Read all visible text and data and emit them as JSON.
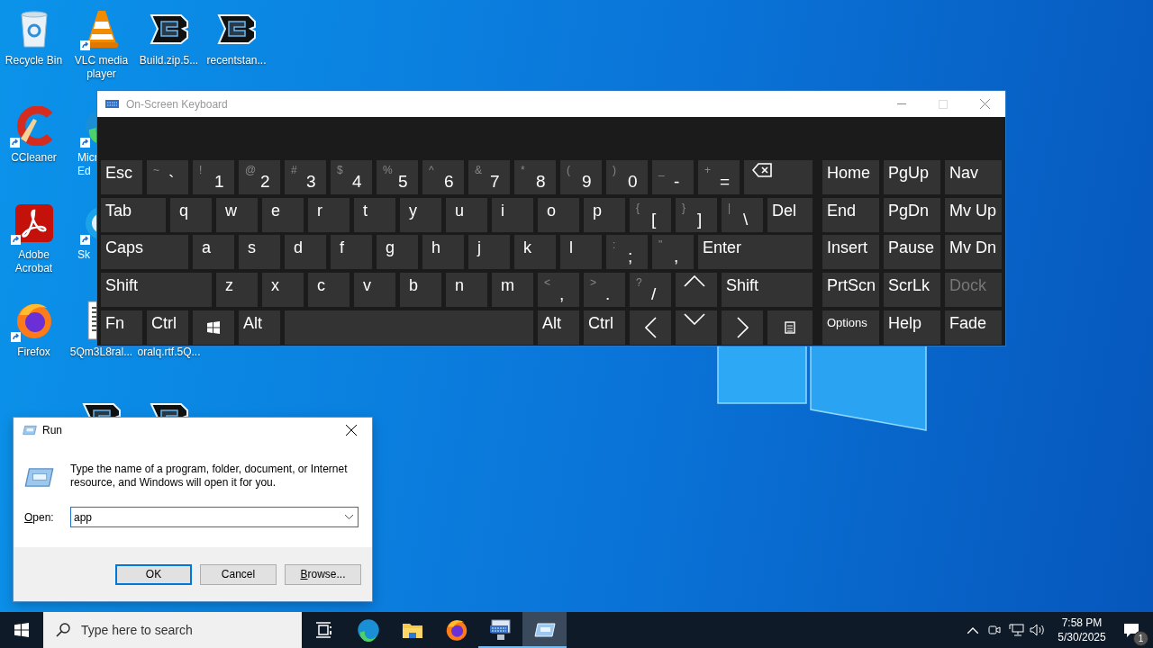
{
  "desktop": {
    "icons": [
      {
        "label": "Recycle Bin",
        "kind": "recycle",
        "shortcut": false
      },
      {
        "label": "VLC media player",
        "kind": "cone",
        "shortcut": true
      },
      {
        "label": "Build.zip.5...",
        "kind": "logo",
        "shortcut": false
      },
      {
        "label": "recentstan...",
        "kind": "logo",
        "shortcut": false
      },
      {
        "label": "CCleaner",
        "kind": "cleaner",
        "shortcut": true
      },
      {
        "lines": [
          "Micr",
          "Ed"
        ],
        "kind": "edge",
        "shortcut": true
      },
      {
        "label": "Adobe Acrobat",
        "kind": "acrobat",
        "shortcut": true
      },
      {
        "lines": [
          "Sk"
        ],
        "kind": "skype",
        "shortcut": true
      },
      {
        "label": "Firefox",
        "kind": "firefox",
        "shortcut": true
      },
      {
        "label": "5Qm3L8ral...",
        "kind": "document",
        "shortcut": false
      },
      {
        "label": "oralq.rtf.5Q..."
      },
      {
        "kind": "logo"
      },
      {
        "kind": "logo"
      }
    ]
  },
  "keyboard": {
    "title": "On-Screen Keyboard",
    "active": false,
    "rows": [
      {
        "keys": [
          {
            "label": "Esc"
          },
          {
            "label": "`",
            "shift": "~"
          },
          {
            "label": "1",
            "shift": "!"
          },
          {
            "label": "2",
            "shift": "@"
          },
          {
            "label": "3",
            "shift": "#"
          },
          {
            "label": "4",
            "shift": "$"
          },
          {
            "label": "5",
            "shift": "%"
          },
          {
            "label": "6",
            "shift": "^"
          },
          {
            "label": "7",
            "shift": "&"
          },
          {
            "label": "8",
            "shift": "*"
          },
          {
            "label": "9",
            "shift": "("
          },
          {
            "label": "0",
            "shift": ")"
          },
          {
            "label": "-",
            "shift": "_"
          },
          {
            "label": "=",
            "shift": "+"
          },
          {
            "kind": "backspace"
          }
        ]
      },
      {
        "keys": [
          {
            "label": "Tab"
          },
          {
            "label": "q"
          },
          {
            "label": "w"
          },
          {
            "label": "e"
          },
          {
            "label": "r"
          },
          {
            "label": "t"
          },
          {
            "label": "y"
          },
          {
            "label": "u"
          },
          {
            "label": "i"
          },
          {
            "label": "o"
          },
          {
            "label": "p"
          },
          {
            "label": "[",
            "shift": "{"
          },
          {
            "label": "]",
            "shift": "}"
          },
          {
            "label": "\\",
            "shift": "|"
          },
          {
            "label": "Del"
          }
        ]
      },
      {
        "keys": [
          {
            "label": "Caps"
          },
          {
            "label": "a"
          },
          {
            "label": "s"
          },
          {
            "label": "d"
          },
          {
            "label": "f"
          },
          {
            "label": "g"
          },
          {
            "label": "h"
          },
          {
            "label": "j"
          },
          {
            "label": "k"
          },
          {
            "label": "l"
          },
          {
            "label": ";",
            "shift": ":"
          },
          {
            "label": ",",
            "shift": "\""
          },
          {
            "label": "Enter"
          }
        ]
      },
      {
        "keys": [
          {
            "label": "Shift"
          },
          {
            "label": "z"
          },
          {
            "label": "x"
          },
          {
            "label": "c"
          },
          {
            "label": "v"
          },
          {
            "label": "b"
          },
          {
            "label": "n"
          },
          {
            "label": "m"
          },
          {
            "label": ",",
            "shift": "<"
          },
          {
            "label": ".",
            "shift": ">"
          },
          {
            "label": "/",
            "shift": "?"
          },
          {
            "kind": "up"
          },
          {
            "label": "Shift"
          }
        ]
      },
      {
        "keys": [
          {
            "label": "Fn"
          },
          {
            "label": "Ctrl"
          },
          {
            "kind": "windows"
          },
          {
            "label": "Alt"
          },
          {
            "kind": "space"
          },
          {
            "label": "Alt"
          },
          {
            "label": "Ctrl"
          },
          {
            "kind": "left"
          },
          {
            "kind": "down"
          },
          {
            "kind": "right"
          },
          {
            "kind": "menu"
          }
        ]
      }
    ],
    "nav_keys": [
      {
        "label": "Home",
        "disabled": false
      },
      {
        "label": "PgUp",
        "disabled": false
      },
      {
        "label": "Nav",
        "disabled": false
      },
      {
        "label": "End",
        "disabled": false
      },
      {
        "label": "PgDn",
        "disabled": false
      },
      {
        "label": "Mv Up",
        "disabled": false
      },
      {
        "label": "Insert",
        "disabled": false
      },
      {
        "label": "Pause",
        "disabled": false
      },
      {
        "label": "Mv Dn",
        "disabled": false
      },
      {
        "label": "PrtScn",
        "disabled": false
      },
      {
        "label": "ScrLk",
        "disabled": false
      },
      {
        "label": "Dock",
        "disabled": true
      },
      {
        "label": "Options",
        "disabled": false
      },
      {
        "label": "Help",
        "disabled": false
      },
      {
        "label": "Fade",
        "disabled": false
      }
    ]
  },
  "run_dialog": {
    "title": "Run",
    "message": "Type the name of a program, folder, document, or Internet resource, and Windows will open it for you.",
    "open_label": "Open:",
    "value": "app",
    "buttons": [
      {
        "label": "OK",
        "default": true
      },
      {
        "label": "Cancel",
        "default": false
      },
      {
        "label": "Browse...",
        "default": false
      }
    ]
  },
  "taskbar": {
    "search": {
      "placeholder": "Type here to search"
    },
    "apps": [
      {
        "kind": "taskview",
        "running": false,
        "selected": false
      },
      {
        "kind": "edge",
        "running": false,
        "selected": false
      },
      {
        "kind": "folder",
        "running": false,
        "selected": false
      },
      {
        "kind": "firefox",
        "running": false,
        "selected": false
      },
      {
        "kind": "keyboard",
        "running": true,
        "selected": false
      },
      {
        "kind": "run",
        "running": true,
        "selected": true
      }
    ],
    "time": "7:58 PM",
    "date": "5/30/2025",
    "notifications": "1"
  }
}
